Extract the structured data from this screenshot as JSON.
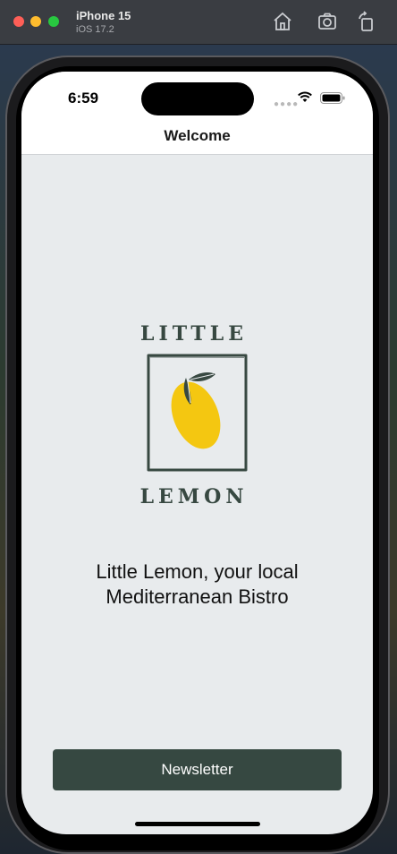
{
  "simulator": {
    "device_name": "iPhone 15",
    "os_version": "iOS 17.2",
    "toolbar_icons": [
      "home-icon",
      "screenshot-icon",
      "rotate-icon"
    ]
  },
  "status_bar": {
    "time": "6:59",
    "icons": [
      "cellular-icon",
      "wifi-icon",
      "battery-icon"
    ]
  },
  "nav": {
    "title": "Welcome"
  },
  "logo": {
    "top_text": "LITTLE",
    "bottom_text": "LEMON",
    "color": "#374841",
    "lemon_color": "#f4c711"
  },
  "main": {
    "tagline_line1": "Little Lemon, your local",
    "tagline_line2": "Mediterranean Bistro"
  },
  "button": {
    "newsletter_label": "Newsletter",
    "color": "#364841"
  }
}
